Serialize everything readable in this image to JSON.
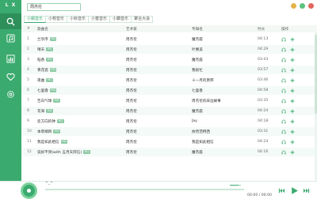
{
  "app": {
    "logo": "L X"
  },
  "sidebar": {
    "items": [
      {
        "icon": "search-icon",
        "active": true
      },
      {
        "icon": "music-note-icon",
        "active": false
      },
      {
        "icon": "chart-bars-icon",
        "active": false
      },
      {
        "icon": "heart-icon",
        "active": false
      },
      {
        "icon": "gear-icon",
        "active": false
      }
    ]
  },
  "search": {
    "value": "周杰伦"
  },
  "window_controls": {
    "colors": [
      "#e6b34a",
      "#5bc27f",
      "#e0655a"
    ]
  },
  "tabs": [
    {
      "label": "小蜗音乐",
      "active": true
    },
    {
      "label": "小枸音乐",
      "active": false
    },
    {
      "label": "小秋音乐",
      "active": false
    },
    {
      "label": "小蜜音乐",
      "active": false
    },
    {
      "label": "小霸音乐",
      "active": false
    },
    {
      "label": "聚合大会",
      "active": false
    }
  ],
  "table": {
    "headers": {
      "index": "#",
      "name": "歌曲名",
      "artist": "艺术家",
      "album": "专辑名",
      "duration": "时长",
      "ops": "操作"
    },
    "rows": [
      {
        "index": "1",
        "name": "兰亭序",
        "badge": "HQ",
        "artist": "周杰伦",
        "album": "魔杰座",
        "duration": "04:13"
      },
      {
        "index": "2",
        "name": "晴天",
        "badge": "HQ",
        "artist": "周杰伦",
        "album": "叶惠美",
        "duration": "04:29"
      },
      {
        "index": "3",
        "name": "稻香",
        "badge": "HQ",
        "artist": "周杰伦",
        "album": "魔杰座",
        "duration": "03:43"
      },
      {
        "index": "4",
        "name": "青花瓷",
        "badge": "HQ",
        "artist": "周杰伦",
        "album": "我很忙",
        "duration": "03:57"
      },
      {
        "index": "5",
        "name": "夜曲",
        "badge": "HQ",
        "artist": "周杰伦",
        "album": "十一月的萧邦",
        "duration": "03:46"
      },
      {
        "index": "6",
        "name": "七里香",
        "badge": "HQ",
        "artist": "周杰伦",
        "album": "七里香",
        "duration": "04:58"
      },
      {
        "index": "7",
        "name": "告白气球",
        "badge": "HQ",
        "artist": "周杰伦",
        "album": "周杰伦的床边故事",
        "duration": "03:35"
      },
      {
        "index": "8",
        "name": "花海",
        "badge": "HQ",
        "artist": "周杰伦",
        "album": "魔杰座",
        "duration": "04:24"
      },
      {
        "index": "9",
        "name": "反方向的钟",
        "badge": "HQ",
        "artist": "周杰伦",
        "album": "Jay",
        "duration": "04:18"
      },
      {
        "index": "10",
        "name": "本草纲目",
        "badge": "HQ",
        "artist": "周杰伦",
        "album": "依然范特西",
        "duration": "03:31"
      },
      {
        "index": "11",
        "name": "我是如此相信",
        "badge": "HQ",
        "artist": "周杰伦",
        "album": "我是如此相信",
        "duration": "04:24"
      },
      {
        "index": "12",
        "name": "说好不哭(with 五月天阿信)",
        "badge": "HQ",
        "artist": "周杰伦",
        "album": "魔杰座",
        "duration": "04:16"
      }
    ]
  },
  "player": {
    "tip": "^_^",
    "time": "00:00 / 00:00",
    "progress": 0.0,
    "volume": 0.8,
    "accent": "#3aaa6e"
  }
}
